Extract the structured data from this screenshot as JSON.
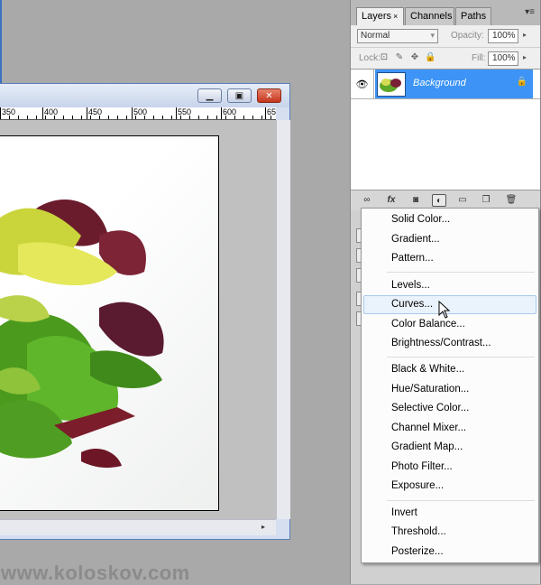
{
  "document": {
    "ruler_numbers": [
      "350",
      "400",
      "450",
      "500",
      "550",
      "600",
      "65"
    ],
    "window_controls": {
      "minimize": "▁",
      "restore": "▣",
      "close": "✕"
    }
  },
  "layers_panel": {
    "tabs": [
      {
        "label": "Layers",
        "close": "×",
        "active": true
      },
      {
        "label": "Channels",
        "active": false
      },
      {
        "label": "Paths",
        "active": false
      }
    ],
    "blend_mode": "Normal",
    "opacity_label": "Opacity:",
    "opacity_value": "100%",
    "lock_label": "Lock:",
    "fill_label": "Fill:",
    "fill_value": "100%",
    "layers": [
      {
        "name": "Background",
        "visible": true,
        "locked": true,
        "selected": true
      }
    ],
    "footer_icons": [
      "link-icon",
      "fx-icon",
      "mask-icon",
      "adjustment-icon",
      "folder-icon",
      "new-layer-icon",
      "trash-icon"
    ],
    "fx_label": "fx"
  },
  "adjustment_menu": {
    "groups": [
      [
        "Solid Color...",
        "Gradient...",
        "Pattern..."
      ],
      [
        "Levels...",
        "Curves...",
        "Color Balance...",
        "Brightness/Contrast..."
      ],
      [
        "Black & White...",
        "Hue/Saturation...",
        "Selective Color...",
        "Channel Mixer...",
        "Gradient Map...",
        "Photo Filter...",
        "Exposure..."
      ],
      [
        "Invert",
        "Threshold...",
        "Posterize..."
      ]
    ],
    "hovered": "Curves..."
  },
  "watermark": "www.koloskov.com",
  "colors": {
    "selection_blue": "#3d94f6",
    "menu_hover": "#eaf2fb",
    "close_red": "#c3351c"
  }
}
